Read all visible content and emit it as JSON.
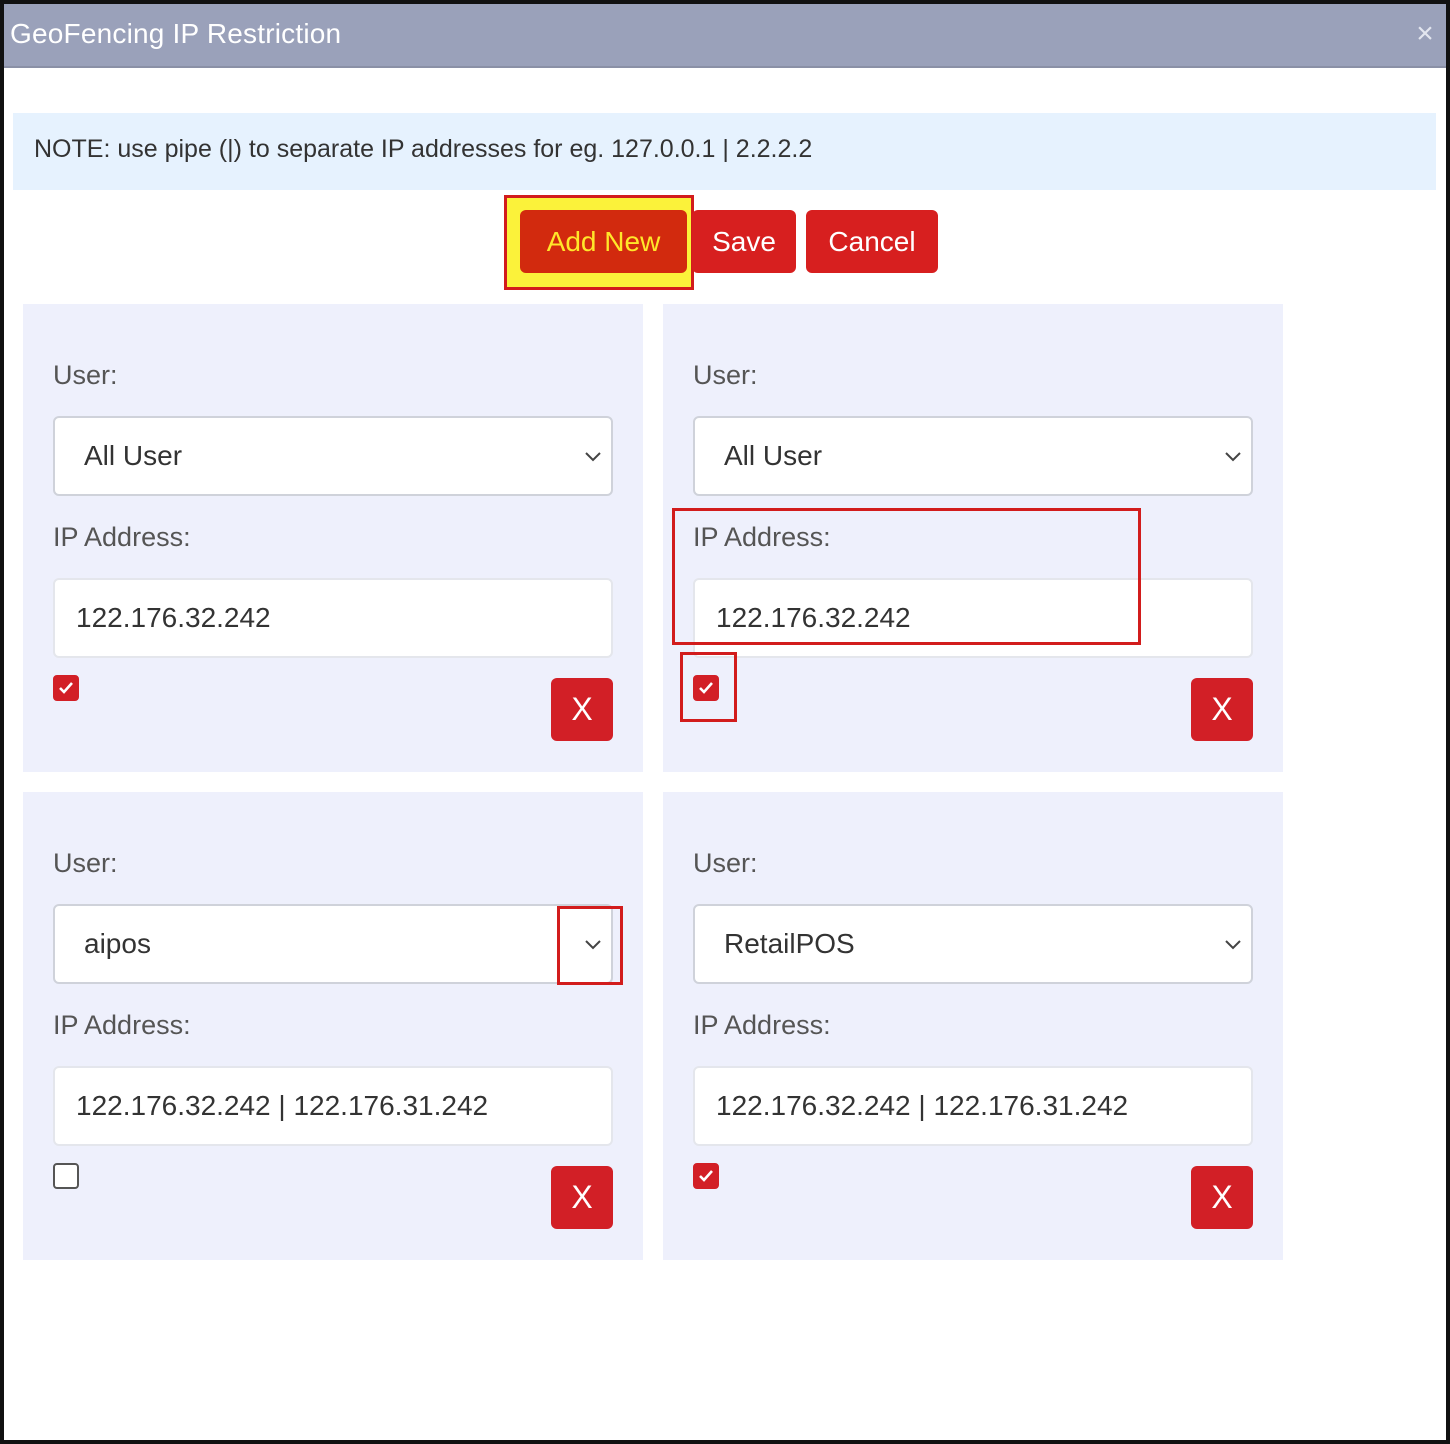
{
  "dialog": {
    "title": "GeoFencing IP Restriction",
    "close_glyph": "×"
  },
  "note": "NOTE: use pipe (|) to separate IP addresses for eg. 127.0.0.1 | 2.2.2.2",
  "toolbar": {
    "add_new_label": "Add New",
    "save_label": "Save",
    "cancel_label": "Cancel"
  },
  "entries": [
    {
      "user_label": "User:",
      "user_value": "All User",
      "ip_label": "IP Address:",
      "ip_value": "122.176.32.242",
      "enabled": true,
      "delete_label": "X"
    },
    {
      "user_label": "User:",
      "user_value": "All User",
      "ip_label": "IP Address:",
      "ip_value": "122.176.32.242",
      "enabled": true,
      "delete_label": "X"
    },
    {
      "user_label": "User:",
      "user_value": "aipos",
      "ip_label": "IP Address:",
      "ip_value": "122.176.32.242 | 122.176.31.242",
      "enabled": false,
      "delete_label": "X"
    },
    {
      "user_label": "User:",
      "user_value": "RetailPOS",
      "ip_label": "IP Address:",
      "ip_value": "122.176.32.242 | 122.176.31.242",
      "enabled": true,
      "delete_label": "X"
    }
  ],
  "icons": {
    "close": "close-icon",
    "dropdown": "chevron-down-icon",
    "check": "checkmark-icon"
  },
  "colors": {
    "titlebar": "#9aa1ba",
    "note_bg": "#e6f2fe",
    "accent_red": "#d21f26",
    "highlight_yellow": "#fbf23a",
    "card_bg": "#eef0fc"
  }
}
